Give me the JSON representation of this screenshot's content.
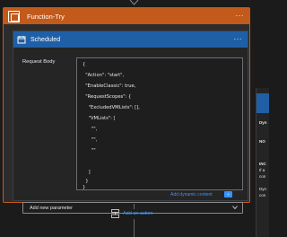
{
  "scope": {
    "title": "Function-Try",
    "menu": "···"
  },
  "trigger": {
    "title": "Scheduled",
    "menu": "···",
    "field_label": "Request Body",
    "code_lines": [
      "{",
      "  \"Action\": \"start\",",
      "  \"EnableClassic\": true,",
      "  \"RequestScopes\": {",
      "    \"ExcludedVMLists\": [],",
      "    \"VMLists\": [",
      "      \"\",",
      "      \"\",",
      "      \"\"",
      "    ]",
      "  }",
      "}"
    ],
    "dynamic_link": "Add dynamic content",
    "dynamic_badge": "+",
    "dropdown_value": "Add new parameter"
  },
  "add_action": {
    "label": "Add an action"
  },
  "side_panel": {
    "lines": [
      "Dyn",
      "NO",
      "INC",
      "If a",
      "con",
      "Dyn",
      "con"
    ]
  },
  "colors": {
    "scope_accent": "#c25a1c",
    "trigger_accent": "#1f5fa6",
    "link": "#3794ff",
    "background": "#1b1b1b"
  },
  "icons": [
    "scope-icon",
    "schedule-icon",
    "chevron-down-icon",
    "add-action-icon",
    "arrow-down-icon"
  ]
}
